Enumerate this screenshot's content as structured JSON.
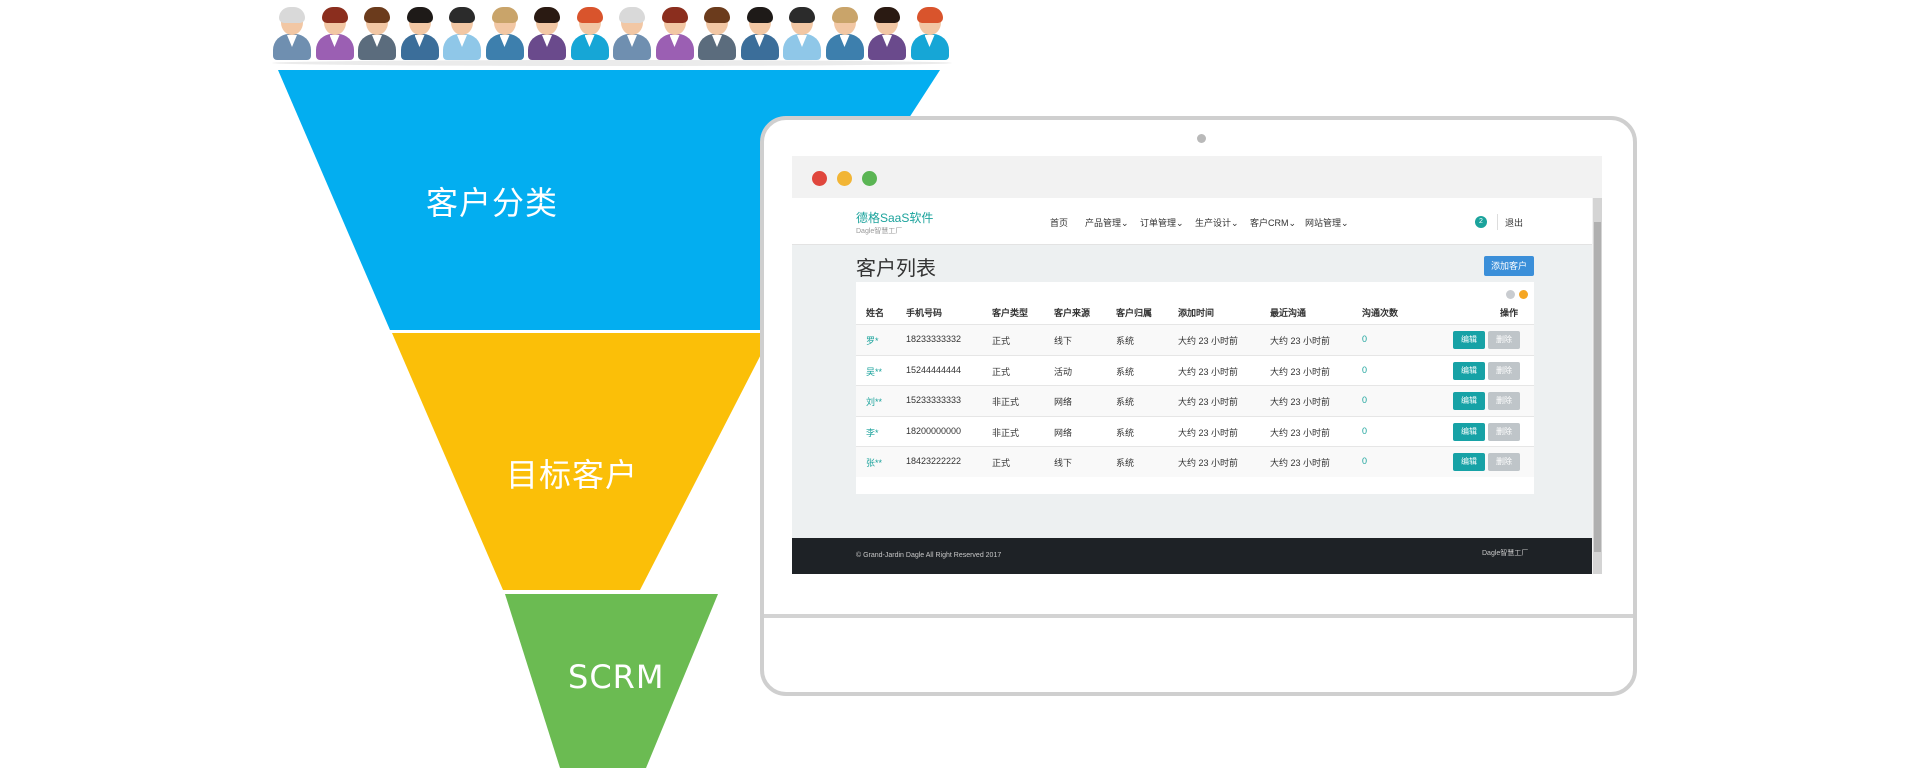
{
  "funnel": {
    "top_label": "客户分类",
    "middle_label": "目标客户",
    "bottom_label": "SCRM",
    "colors": {
      "top": "#03aef0",
      "middle": "#fbbf08",
      "bottom": "#6bbb52"
    }
  },
  "people": [
    {
      "hair": "#d9d9d9",
      "shirt": "#6f8fb0"
    },
    {
      "hair": "#8b2e1e",
      "shirt": "#9b5fb3"
    },
    {
      "hair": "#6b3b1c",
      "shirt": "#5b6c7d"
    },
    {
      "hair": "#1e1a18",
      "shirt": "#3b6e9a"
    },
    {
      "hair": "#2b2b2b",
      "shirt": "#8fc7e8"
    },
    {
      "hair": "#c9a46a",
      "shirt": "#3d7fad"
    },
    {
      "hair": "#2a1a12",
      "shirt": "#6a4a8c"
    },
    {
      "hair": "#d9542c",
      "shirt": "#16a6d6"
    },
    {
      "hair": "#d9d9d9",
      "shirt": "#6f8fb0"
    },
    {
      "hair": "#8b2e1e",
      "shirt": "#9b5fb3"
    },
    {
      "hair": "#6b3b1c",
      "shirt": "#5b6c7d"
    },
    {
      "hair": "#1e1a18",
      "shirt": "#3b6e9a"
    },
    {
      "hair": "#2b2b2b",
      "shirt": "#8fc7e8"
    },
    {
      "hair": "#c9a46a",
      "shirt": "#3d7fad"
    },
    {
      "hair": "#2a1a12",
      "shirt": "#6a4a8c"
    },
    {
      "hair": "#d9542c",
      "shirt": "#16a6d6"
    }
  ],
  "window": {
    "traffic_colors": [
      "#e0473d",
      "#f2b535",
      "#5bb554"
    ]
  },
  "app": {
    "brand": "德格SaaS软件",
    "brand_sub": "Dagle智慧工厂",
    "nav": [
      "首页",
      "产品管理⌄",
      "订单管理⌄",
      "生产设计⌄",
      "客户CRM⌄",
      "网站管理⌄"
    ],
    "badge": "2",
    "logout": "退出",
    "page_title": "客户列表",
    "add_button": "添加客户",
    "table": {
      "headers": [
        "姓名",
        "手机号码",
        "客户类型",
        "客户来源",
        "客户归属",
        "添加时间",
        "最近沟通",
        "沟通次数",
        "操作"
      ],
      "rows": [
        [
          "罗*",
          "18233333332",
          "正式",
          "线下",
          "系统",
          "大约 23 小时前",
          "大约 23 小时前",
          "0"
        ],
        [
          "吴**",
          "15244444444",
          "正式",
          "活动",
          "系统",
          "大约 23 小时前",
          "大约 23 小时前",
          "0"
        ],
        [
          "刘**",
          "15233333333",
          "非正式",
          "网络",
          "系统",
          "大约 23 小时前",
          "大约 23 小时前",
          "0"
        ],
        [
          "李*",
          "18200000000",
          "非正式",
          "网络",
          "系统",
          "大约 23 小时前",
          "大约 23 小时前",
          "0"
        ],
        [
          "张**",
          "18423222222",
          "正式",
          "线下",
          "系统",
          "大约 23 小时前",
          "大约 23 小时前",
          "0"
        ]
      ],
      "edit_label": "编辑",
      "delete_label": "删除"
    },
    "footer_copy": "© Grand-Jardin Dagle All Right Reserved 2017",
    "footer_right": "Dagle智慧工厂"
  }
}
